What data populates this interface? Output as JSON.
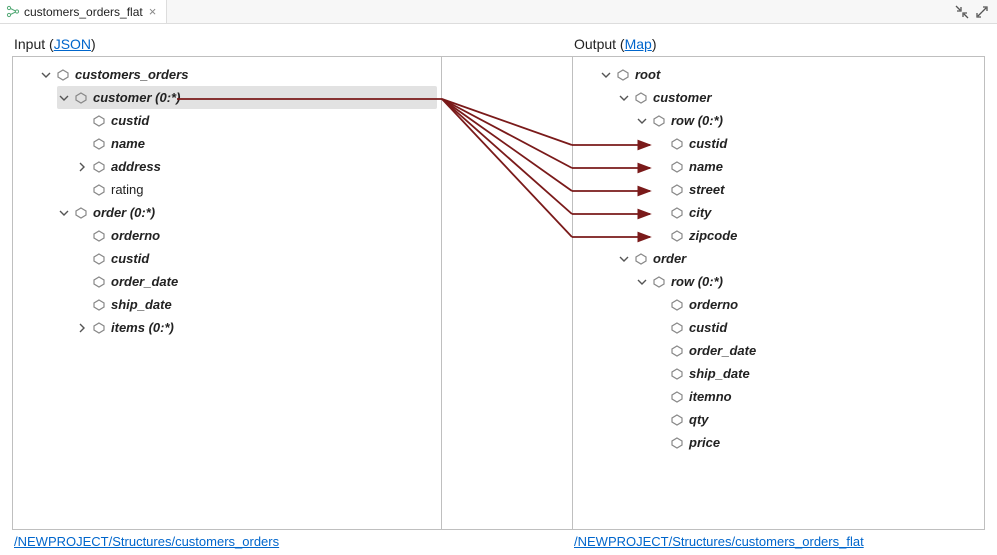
{
  "tab": {
    "title": "customers_orders_flat"
  },
  "input": {
    "header_prefix": "Input (",
    "header_link": "JSON",
    "header_suffix": ")",
    "footer_link": "/NEWPROJECT/Structures/customers_orders",
    "tree": {
      "root": "customers_orders",
      "customer": "customer (0:*)",
      "custid": "custid",
      "name": "name",
      "address": "address",
      "rating": "rating",
      "order": "order (0:*)",
      "orderno": "orderno",
      "o_custid": "custid",
      "order_date": "order_date",
      "ship_date": "ship_date",
      "items": "items (0:*)"
    }
  },
  "output": {
    "header_prefix": "Output (",
    "header_link": "Map",
    "header_suffix": ")",
    "footer_link": "/NEWPROJECT/Structures/customers_orders_flat",
    "tree": {
      "root": "root",
      "customer": "customer",
      "c_row": "row (0:*)",
      "custid": "custid",
      "name": "name",
      "street": "street",
      "city": "city",
      "zipcode": "zipcode",
      "order": "order",
      "o_row": "row (0:*)",
      "orderno": "orderno",
      "o_custid": "custid",
      "order_date": "order_date",
      "ship_date": "ship_date",
      "itemno": "itemno",
      "qty": "qty",
      "price": "price"
    }
  }
}
